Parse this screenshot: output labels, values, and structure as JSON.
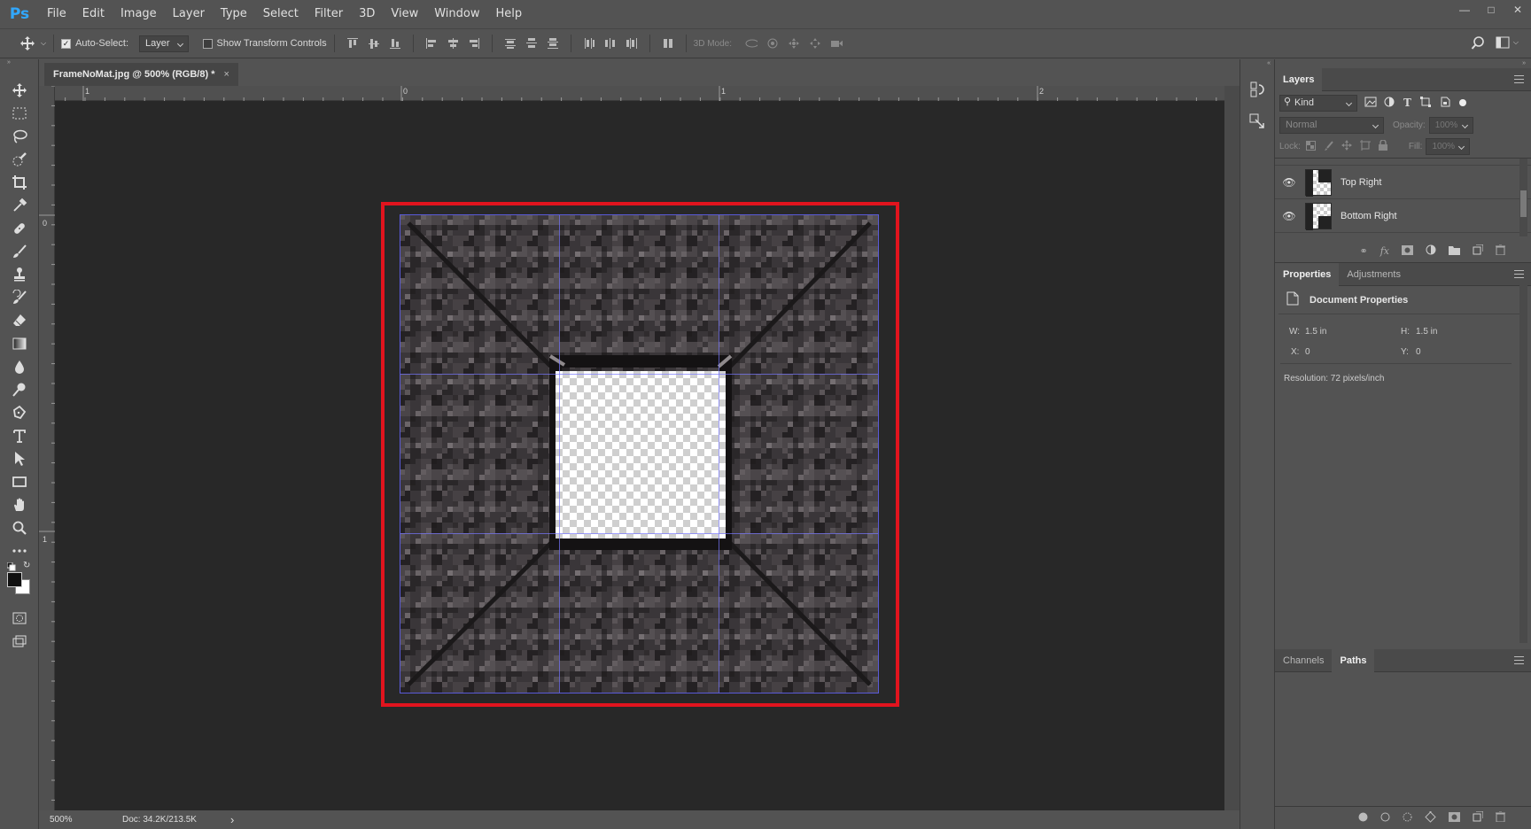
{
  "app": {
    "logo": "Ps"
  },
  "menu": [
    "File",
    "Edit",
    "Image",
    "Layer",
    "Type",
    "Select",
    "Filter",
    "3D",
    "View",
    "Window",
    "Help"
  ],
  "options": {
    "auto_select_label": "Auto-Select:",
    "auto_select_checked": true,
    "auto_select_target": "Layer",
    "show_transform_label": "Show Transform Controls",
    "show_transform_checked": false,
    "mode_3d_label": "3D Mode:"
  },
  "document": {
    "tab_title": "FrameNoMat.jpg @ 500% (RGB/8) *",
    "close_glyph": "×"
  },
  "rulers": {
    "top": [
      "1",
      "0",
      "1",
      "2"
    ],
    "left": [
      "0",
      "1"
    ]
  },
  "status": {
    "zoom": "500%",
    "doc_info": "Doc: 34.2K/213.5K",
    "arrow": "›"
  },
  "layers_panel": {
    "title": "Layers",
    "filter_kind": "Kind",
    "blend_mode": "Normal",
    "opacity_label": "Opacity:",
    "opacity_value": "100%",
    "lock_label": "Lock:",
    "fill_label": "Fill:",
    "fill_value": "100%",
    "layers": [
      {
        "name": "Top Right",
        "visible": true
      },
      {
        "name": "Bottom Right",
        "visible": true
      }
    ]
  },
  "properties_panel": {
    "tabs": [
      "Properties",
      "Adjustments"
    ],
    "heading": "Document Properties",
    "w_label": "W:",
    "w_value": "1.5 in",
    "h_label": "H:",
    "h_value": "1.5 in",
    "x_label": "X:",
    "x_value": "0",
    "y_label": "Y:",
    "y_value": "0",
    "resolution": "Resolution: 72 pixels/inch"
  },
  "paths_panel": {
    "tabs": [
      "Channels",
      "Paths"
    ]
  },
  "colors": {
    "frame_outline": "#e1141e",
    "guides": "#7878ff",
    "ps_blue": "#31a8ff"
  }
}
